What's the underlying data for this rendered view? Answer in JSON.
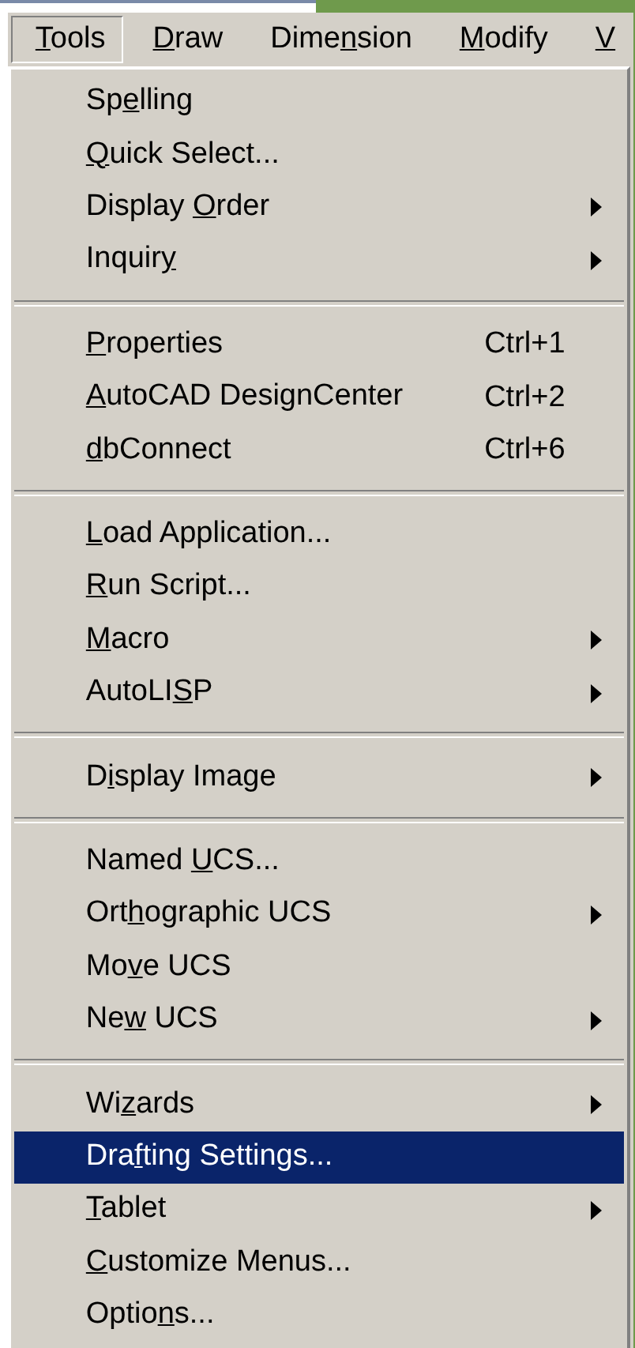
{
  "menu_bar": [
    {
      "key": "T",
      "after": "ools",
      "selected": true
    },
    {
      "key": "D",
      "after": "raw",
      "selected": false
    },
    {
      "before": "Dime",
      "key": "n",
      "after": "sion",
      "selected": false
    },
    {
      "key": "M",
      "after": "odify",
      "selected": false
    },
    {
      "key": "V",
      "selected": false
    }
  ],
  "menu": {
    "items": [
      {
        "kind": "item",
        "before": "Sp",
        "key": "e",
        "after": "lling",
        "submenu": false,
        "selected": false
      },
      {
        "kind": "item",
        "key": "Q",
        "after": "uick Select...",
        "submenu": false,
        "selected": false
      },
      {
        "kind": "item",
        "before": "Display ",
        "key": "O",
        "after": "rder",
        "submenu": true,
        "selected": false
      },
      {
        "kind": "item",
        "before": "Inquir",
        "key": "y",
        "submenu": true,
        "selected": false
      },
      {
        "kind": "separator"
      },
      {
        "kind": "item",
        "key": "P",
        "after": "roperties",
        "shortcut": "Ctrl+1",
        "submenu": false,
        "selected": false
      },
      {
        "kind": "item",
        "key": "A",
        "after": "utoCAD DesignCenter",
        "shortcut": "Ctrl+2",
        "submenu": false,
        "selected": false
      },
      {
        "kind": "item",
        "key": "d",
        "after": "bConnect",
        "shortcut": "Ctrl+6",
        "submenu": false,
        "selected": false
      },
      {
        "kind": "separator"
      },
      {
        "kind": "item",
        "key": "L",
        "after": "oad Application...",
        "submenu": false,
        "selected": false
      },
      {
        "kind": "item",
        "key": "R",
        "after": "un Script...",
        "submenu": false,
        "selected": false
      },
      {
        "kind": "item",
        "key": "M",
        "after": "acro",
        "submenu": true,
        "selected": false
      },
      {
        "kind": "item",
        "before": "AutoLI",
        "key": "S",
        "after": "P",
        "submenu": true,
        "selected": false
      },
      {
        "kind": "separator"
      },
      {
        "kind": "item",
        "before": "D",
        "key": "i",
        "after": "splay Image",
        "submenu": true,
        "selected": false
      },
      {
        "kind": "separator"
      },
      {
        "kind": "item",
        "before": "Named ",
        "key": "U",
        "after": "CS...",
        "submenu": false,
        "selected": false
      },
      {
        "kind": "item",
        "before": "Ort",
        "key": "h",
        "after": "ographic UCS",
        "submenu": true,
        "selected": false
      },
      {
        "kind": "item",
        "before": "Mo",
        "key": "v",
        "after": "e UCS",
        "submenu": false,
        "selected": false
      },
      {
        "kind": "item",
        "before": "Ne",
        "key": "w",
        "after": " UCS",
        "submenu": true,
        "selected": false
      },
      {
        "kind": "separator"
      },
      {
        "kind": "item",
        "before": "Wi",
        "key": "z",
        "after": "ards",
        "submenu": true,
        "selected": false
      },
      {
        "kind": "item",
        "before": "Dra",
        "key": "f",
        "after": "ting Settings...",
        "submenu": false,
        "selected": true
      },
      {
        "kind": "item",
        "key": "T",
        "after": "ablet",
        "submenu": true,
        "selected": false
      },
      {
        "kind": "item",
        "key": "C",
        "after": "ustomize Menus...",
        "submenu": false,
        "selected": false
      },
      {
        "kind": "item",
        "before": "Optio",
        "key": "n",
        "after": "s...",
        "submenu": false,
        "selected": false
      }
    ]
  }
}
